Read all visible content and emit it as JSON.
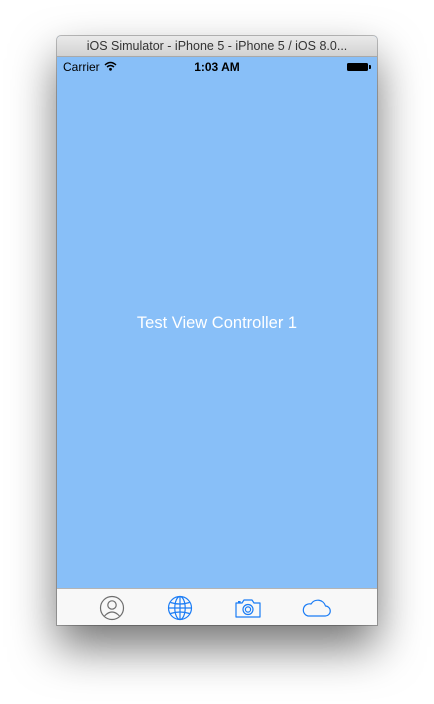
{
  "window": {
    "title": "iOS Simulator - iPhone 5 - iPhone 5 / iOS 8.0..."
  },
  "status_bar": {
    "carrier": "Carrier",
    "time": "1:03 AM"
  },
  "content": {
    "label": "Test View Controller 1",
    "background_color": "#88bff8"
  },
  "tab_bar": {
    "tabs": [
      {
        "icon": "contacts-icon",
        "selected": false
      },
      {
        "icon": "globe-icon",
        "selected": true
      },
      {
        "icon": "camera-icon",
        "selected": true
      },
      {
        "icon": "cloud-icon",
        "selected": true
      }
    ],
    "accent_color": "#1a7cf5",
    "inactive_color": "#8e8e8e"
  }
}
